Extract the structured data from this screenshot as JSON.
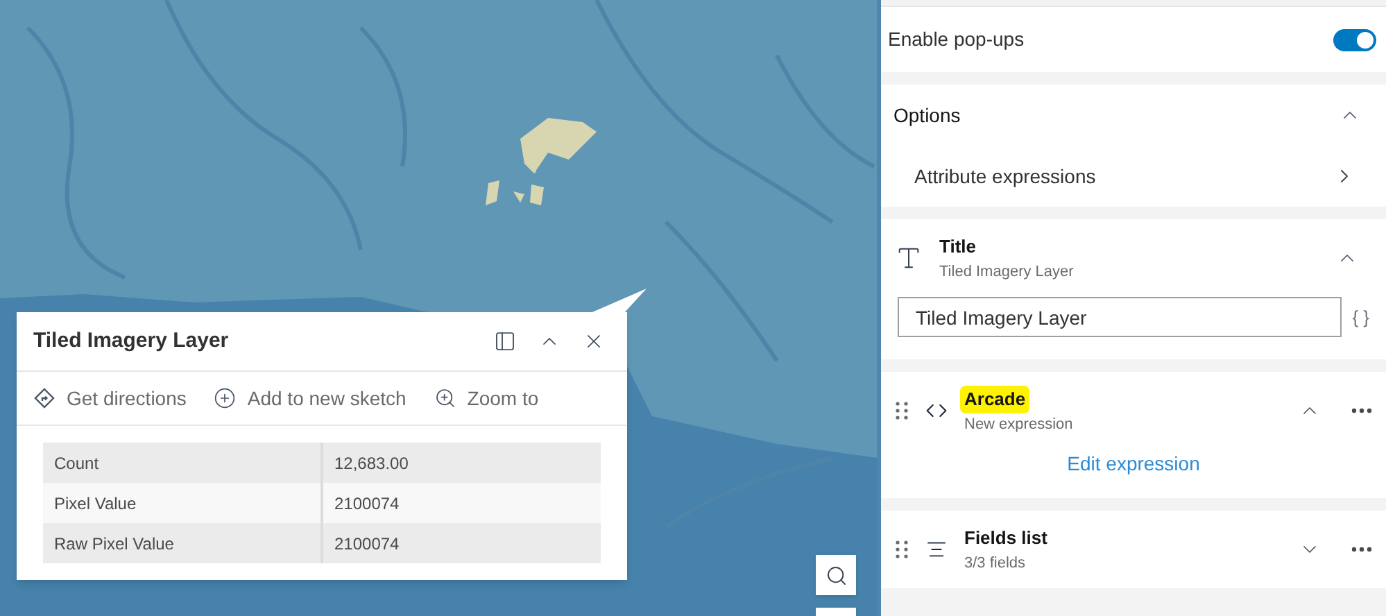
{
  "popup": {
    "title": "Tiled Imagery Layer",
    "actions": [
      {
        "kind": "directions",
        "label": "Get directions"
      },
      {
        "kind": "add",
        "label": "Add to new sketch"
      },
      {
        "kind": "zoom",
        "label": "Zoom to"
      }
    ],
    "table": {
      "rows": [
        {
          "field": "Count",
          "value": "12,683.00"
        },
        {
          "field": "Pixel Value",
          "value": "2100074"
        },
        {
          "field": "Raw Pixel Value",
          "value": "2100074"
        }
      ]
    }
  },
  "panel": {
    "enable_popups": {
      "label": "Enable pop-ups",
      "on": true
    },
    "options": {
      "title": "Options",
      "expanded": true,
      "items": [
        "Attribute expressions"
      ]
    },
    "elements": [
      {
        "kind": "title",
        "title": "Title",
        "subtitle": "Tiled Imagery Layer",
        "expanded": true,
        "value": "Tiled Imagery Layer",
        "expression_button": "{ }",
        "highlighted": false
      },
      {
        "kind": "arcade",
        "title": "Arcade",
        "subtitle": "New expression",
        "expanded": true,
        "link": "Edit expression",
        "highlighted": true
      },
      {
        "kind": "fields",
        "title": "Fields list",
        "subtitle": "3/3 fields",
        "expanded": false,
        "highlighted": false
      }
    ]
  }
}
